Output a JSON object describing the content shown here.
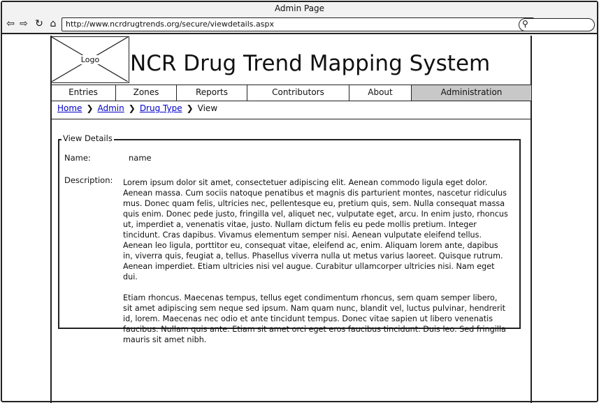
{
  "browser": {
    "title": "Admin Page",
    "url": "http://www.ncrdrugtrends.org/secure/viewdetails.aspx",
    "icons": [
      "back-arrow-icon",
      "forward-arrow-icon",
      "reload-icon",
      "home-icon",
      "search-icon"
    ]
  },
  "header": {
    "logo_label": "Logo",
    "site_title": "NCR Drug Trend Mapping System"
  },
  "nav": {
    "tabs": [
      "Entries",
      "Zones",
      "Reports",
      "Contributors",
      "About",
      "Administration"
    ],
    "active": "Administration",
    "active_color": "#c8c8c8"
  },
  "breadcrumb": {
    "links": [
      "Home",
      "Admin",
      "Drug Type"
    ],
    "current": "View"
  },
  "details": {
    "legend": "View Details",
    "name_label": "Name:",
    "name_value": "name",
    "description_label": "Description:",
    "description_paragraphs": [
      "Lorem ipsum dolor sit amet, consectetuer adipiscing elit. Aenean commodo ligula eget dolor. Aenean massa. Cum sociis natoque penatibus et magnis dis parturient montes, nascetur ridiculus mus. Donec quam felis, ultricies nec, pellentesque eu, pretium quis, sem. Nulla consequat massa quis enim. Donec pede justo, fringilla vel, aliquet nec, vulputate eget, arcu. In enim justo, rhoncus ut, imperdiet a, venenatis vitae, justo. Nullam dictum felis eu pede mollis pretium. Integer tincidunt. Cras dapibus. Vivamus elementum semper nisi. Aenean vulputate eleifend tellus. Aenean leo ligula, porttitor eu, consequat vitae, eleifend ac, enim. Aliquam lorem ante, dapibus in, viverra quis, feugiat a, tellus. Phasellus viverra nulla ut metus varius laoreet. Quisque rutrum. Aenean imperdiet. Etiam ultricies nisi vel augue. Curabitur ullamcorper ultricies nisi. Nam eget dui.",
      "Etiam rhoncus. Maecenas tempus, tellus eget condimentum rhoncus, sem quam semper libero, sit amet adipiscing sem neque sed ipsum. Nam quam nunc, blandit vel, luctus pulvinar, hendrerit id, lorem. Maecenas nec odio et ante tincidunt tempus. Donec vitae sapien ut libero venenatis faucibus. Nullam quis ante. Etiam sit amet orci eget eros faucibus tincidunt. Duis leo. Sed fringilla mauris sit amet nibh."
    ]
  }
}
